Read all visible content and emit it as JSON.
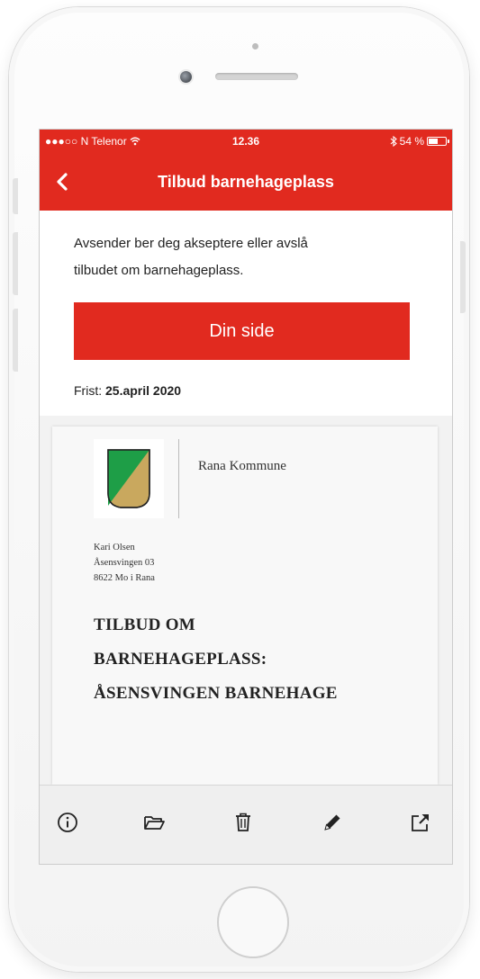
{
  "status_bar": {
    "carrier": "●●●○○ N Telenor",
    "time": "12.36",
    "battery_text": "54 %",
    "battery_level": 0.54
  },
  "nav": {
    "title": "Tilbud barnehageplass",
    "back_icon": "chevron-left-icon"
  },
  "content": {
    "intro_line1": "Avsender ber deg akseptere eller avslå",
    "intro_line2": "tilbudet om barnehageplass.",
    "primary_button": "Din side",
    "deadline_label": "Frist:",
    "deadline_value": "25.april 2020"
  },
  "document": {
    "org_name": "Rana Kommune",
    "recipient_name": "Kari Olsen",
    "recipient_street": "Åsensvingen 03",
    "recipient_city": "8622 Mo i Rana",
    "title_line1": "TILBUD OM",
    "title_line2": "BARNEHAGEPLASS:",
    "title_line3": "ÅSENSVINGEN BARNEHAGE"
  },
  "toolbar": {
    "icons": [
      "info-icon",
      "folder-icon",
      "trash-icon",
      "pencil-icon",
      "share-icon"
    ]
  },
  "colors": {
    "brand_red": "#e12a1f",
    "logo_green": "#1e9e47",
    "logo_gold": "#c9a85e"
  }
}
